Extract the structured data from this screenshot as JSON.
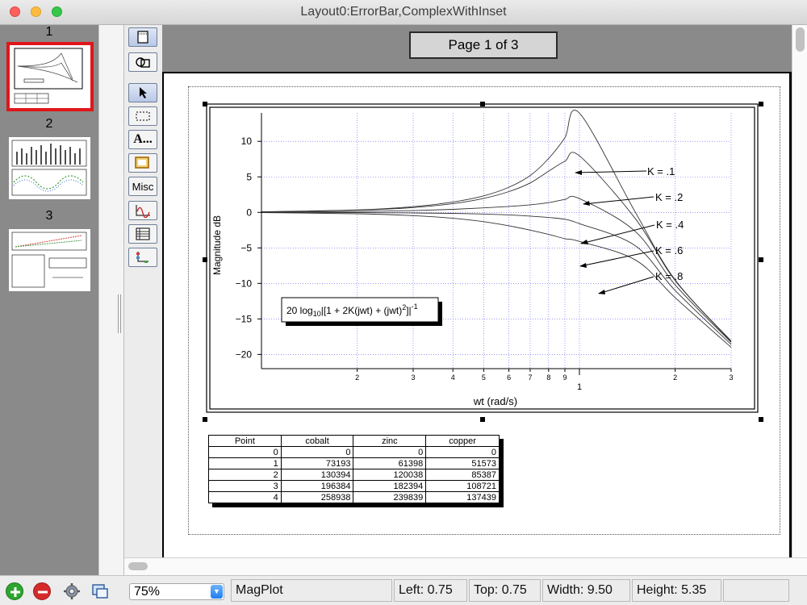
{
  "window": {
    "title": "Layout0:ErrorBar,ComplexWithInset"
  },
  "sidebar": {
    "pages": [
      {
        "number": "1",
        "selected": true
      },
      {
        "number": "2",
        "selected": false
      },
      {
        "number": "3",
        "selected": false
      }
    ]
  },
  "canvas": {
    "page_label": "Page 1 of 3"
  },
  "graph": {
    "y_label": "Magnitude dB",
    "x_label": "wt (rad/s)",
    "inset_formula": "20 log10|[1 + 2K(jwt) + (jwt)2]|-1",
    "y_ticks": [
      "10",
      "5",
      "0",
      "−5",
      "−10",
      "−15",
      "−20"
    ],
    "x_minor_ticks": [
      "2",
      "3",
      "4",
      "5",
      "6",
      "7",
      "8",
      "9",
      "2",
      "3"
    ],
    "x_major_tick": "1",
    "annotations": [
      "K = .1",
      "K = .2",
      "K = .4",
      "K = .6",
      "K = .8"
    ]
  },
  "chart_data": {
    "type": "line",
    "xlabel": "wt (rad/s)",
    "ylabel": "Magnitude dB",
    "x_scale": "log",
    "x": [
      0.1,
      0.2,
      0.3,
      0.4,
      0.5,
      0.6,
      0.7,
      0.8,
      0.9,
      1.0,
      1.5,
      2.0,
      3.0
    ],
    "ylim": [
      -22,
      14
    ],
    "series": [
      {
        "name": "K = .1",
        "values": [
          0.09,
          0.35,
          0.8,
          1.46,
          2.33,
          3.54,
          5.19,
          7.58,
          10.5,
          13.98,
          0.0,
          -9.5,
          -18.1
        ]
      },
      {
        "name": "K = .2",
        "values": [
          0.07,
          0.3,
          0.68,
          1.23,
          1.97,
          2.93,
          4.14,
          5.8,
          7.2,
          7.96,
          -0.9,
          -9.6,
          -18.2
        ]
      },
      {
        "name": "K = .4",
        "values": [
          0.03,
          0.12,
          0.25,
          0.43,
          0.63,
          0.84,
          1.06,
          1.37,
          1.82,
          1.94,
          -2.7,
          -10.2,
          -18.3
        ]
      },
      {
        "name": "K = .6",
        "values": [
          -0.01,
          -0.03,
          -0.08,
          -0.14,
          -0.23,
          -0.36,
          -0.52,
          -0.72,
          -0.97,
          -1.58,
          -4.7,
          -11.0,
          -18.6
        ]
      },
      {
        "name": "K = .8",
        "values": [
          -0.04,
          -0.2,
          -0.46,
          -0.83,
          -1.31,
          -1.89,
          -2.5,
          -3.1,
          -3.7,
          -4.08,
          -6.7,
          -12.0,
          -19.0
        ]
      }
    ]
  },
  "table": {
    "headers": [
      "Point",
      "cobalt",
      "zinc",
      "copper"
    ],
    "rows": [
      [
        "0",
        "0",
        "0",
        "0"
      ],
      [
        "1",
        "73193",
        "61398",
        "51573"
      ],
      [
        "2",
        "130394",
        "120038",
        "85387"
      ],
      [
        "3",
        "196384",
        "182394",
        "108721"
      ],
      [
        "4",
        "258938",
        "239839",
        "137439"
      ]
    ]
  },
  "status": {
    "zoom": "75%",
    "object": "MagPlot",
    "left": "Left: 0.75",
    "top": "Top: 0.75",
    "width": "Width: 9.50",
    "height": "Height: 5.35"
  },
  "colors": {
    "selection": "#e0161a",
    "grid": "#5a5af0",
    "tool_blue": "#b8c8e6"
  },
  "icons": [
    "add-page-icon",
    "remove-page-icon",
    "gear-icon",
    "export-icon",
    "layout-mode-icon",
    "drawing-mode-icon",
    "arrow-tool-icon",
    "marquee-tool-icon",
    "text-tool-icon",
    "frame-tool-icon",
    "misc-tool-icon",
    "graph-tool-icon",
    "table-tool-icon",
    "axis-tool-icon"
  ]
}
